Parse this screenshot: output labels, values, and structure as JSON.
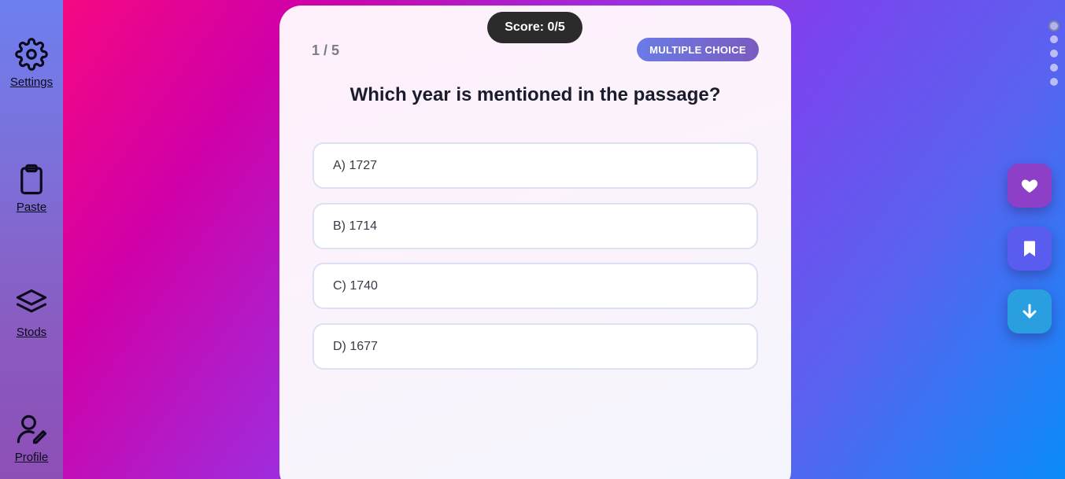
{
  "sidebar": {
    "items": [
      {
        "label": "Settings",
        "icon": "gear-icon"
      },
      {
        "label": "Paste",
        "icon": "clipboard-icon"
      },
      {
        "label": "Stods",
        "icon": "layers-icon"
      },
      {
        "label": "Profile",
        "icon": "user-edit-icon"
      }
    ]
  },
  "quiz": {
    "score": "Score: 0/5",
    "progress": "1 / 5",
    "type_badge": "MULTIPLE CHOICE",
    "question": "Which year is mentioned in the passage?",
    "options": [
      "A) 1727",
      "B) 1714",
      "C) 1740",
      "D) 1677"
    ]
  },
  "pager": {
    "count": 5,
    "active_index": 0
  },
  "actions": [
    {
      "name": "like",
      "icon": "heart-icon",
      "color": "#8e3fc8"
    },
    {
      "name": "bookmark",
      "icon": "bookmark-icon",
      "color": "#5a5cf0"
    },
    {
      "name": "download",
      "icon": "arrow-down-icon",
      "color": "#2a9fe0"
    }
  ],
  "colors": {
    "score_pill": "#2b2b2b",
    "badge_start": "#6a7be6",
    "badge_end": "#7a5bbf",
    "option_border": "#dde0f3"
  }
}
